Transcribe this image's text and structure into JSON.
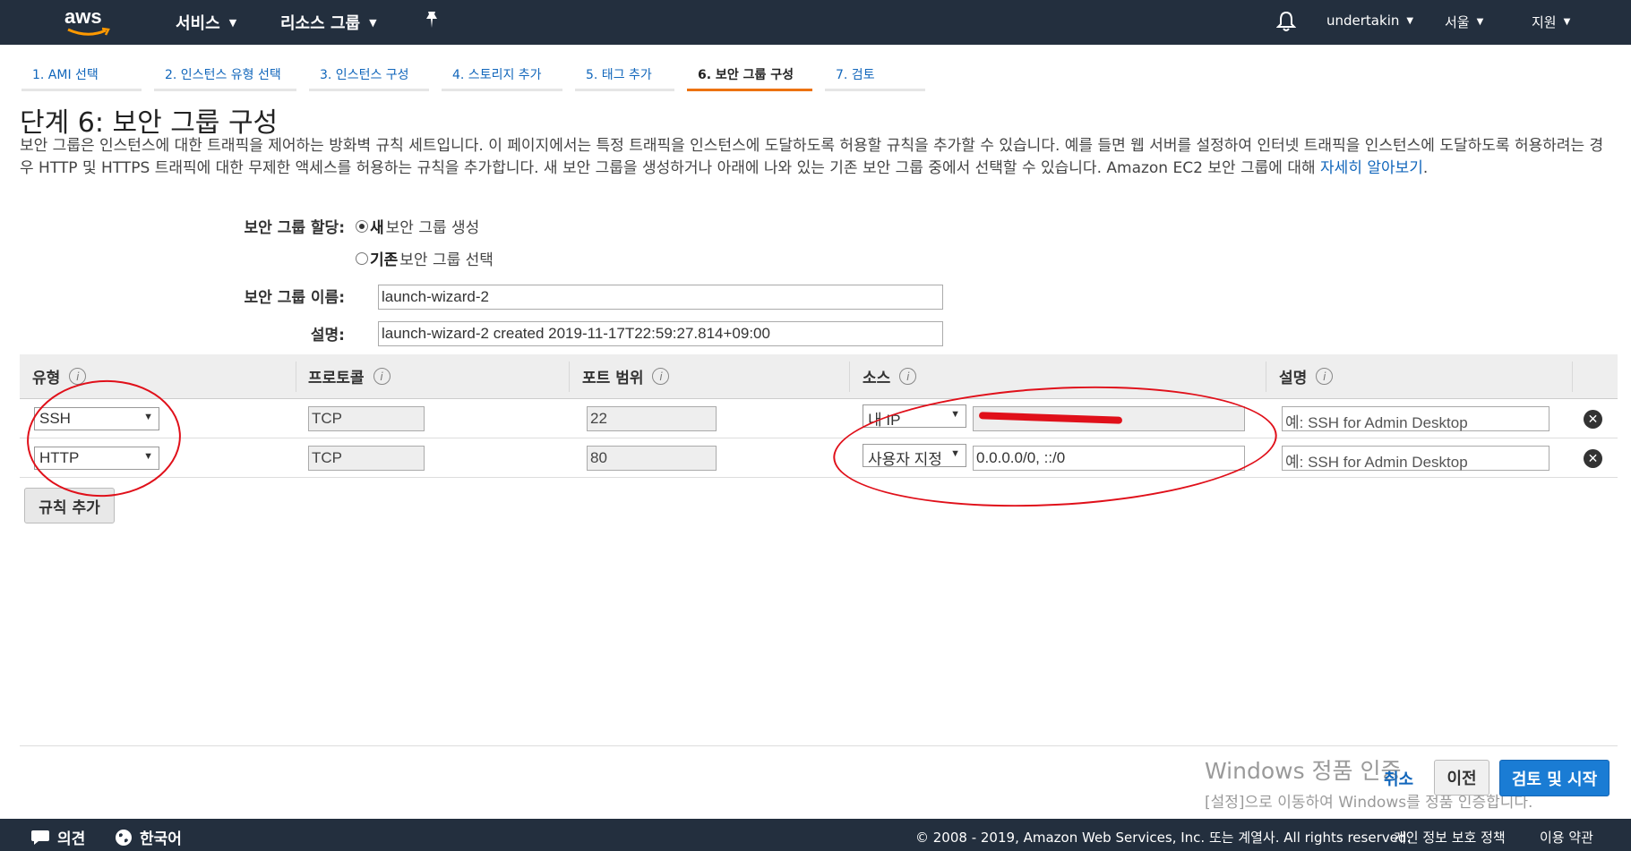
{
  "nav": {
    "logo_text": "aws",
    "services": "서비스",
    "resource_groups": "리소스 그룹",
    "user": "undertakin",
    "region": "서울",
    "support": "지원"
  },
  "steps": [
    {
      "label": "1. AMI 선택"
    },
    {
      "label": "2. 인스턴스 유형 선택"
    },
    {
      "label": "3. 인스턴스 구성"
    },
    {
      "label": "4. 스토리지 추가"
    },
    {
      "label": "5. 태그 추가"
    },
    {
      "label": "6. 보안 그룹 구성"
    },
    {
      "label": "7. 검토"
    }
  ],
  "page": {
    "title": "단계 6: 보안 그룹 구성",
    "description": "보안 그룹은 인스턴스에 대한 트래픽을 제어하는 방화벽 규칙 세트입니다. 이 페이지에서는 특정 트래픽을 인스턴스에 도달하도록 허용할 규칙을 추가할 수 있습니다. 예를 들면 웹 서버를 설정하여 인터넷 트래픽을 인스턴스에 도달하도록 허용하려는 경우 HTTP 및 HTTPS 트래픽에 대한 무제한 액세스를 허용하는 규칙을 추가합니다. 새 보안 그룹을 생성하거나 아래에 나와 있는 기존 보안 그룹 중에서 선택할 수 있습니다. Amazon EC2 보안 그룹에 대해 ",
    "learn_more": "자세히 알아보기",
    "period": "."
  },
  "form": {
    "assign_label": "보안 그룹 할당:",
    "option_new_bold": "새",
    "option_new_rest": " 보안 그룹 생성",
    "option_existing_bold": "기존",
    "option_existing_rest": " 보안 그룹 선택",
    "name_label": "보안 그룹 이름:",
    "name_value": "launch-wizard-2",
    "desc_label": "설명:",
    "desc_value": "launch-wizard-2 created 2019-11-17T22:59:27.814+09:00"
  },
  "table": {
    "headers": [
      "유형",
      "프로토콜",
      "포트 범위",
      "소스",
      "설명"
    ],
    "info_glyph": "i",
    "rows": [
      {
        "type": "SSH",
        "protocol": "TCP",
        "port": "22",
        "source_type": "내 IP",
        "source_value": "",
        "description_placeholder": "예: SSH for Admin Desktop"
      },
      {
        "type": "HTTP",
        "protocol": "TCP",
        "port": "80",
        "source_type": "사용자 지정",
        "source_value": "0.0.0.0/0, ::/0",
        "description_placeholder": "예: SSH for Admin Desktop"
      }
    ],
    "add_rule": "규칙 추가"
  },
  "actions": {
    "cancel": "취소",
    "previous": "이전",
    "review_launch": "검토 및 시작"
  },
  "watermark": {
    "line1": "Windows 정품 인증",
    "line2": "[설정]으로 이동하여 Windows를 정품 인증합니다."
  },
  "footer": {
    "feedback": "의견",
    "language": "한국어",
    "copyright": "© 2008 - 2019, Amazon Web Services, Inc. 또는 계열사. All rights reserved.",
    "privacy": "개인 정보 보호 정책",
    "terms": "이용 약관"
  },
  "colors": {
    "nav_bg": "#232f3e",
    "link": "#1166bb",
    "active_tab": "#ec7211",
    "primary_button": "#1a7cd4",
    "annotation": "#e0101a"
  }
}
